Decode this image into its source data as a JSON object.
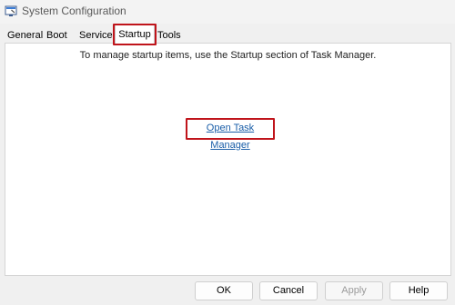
{
  "window": {
    "title": "System Configuration",
    "icon": "system-configuration-icon"
  },
  "tabs": [
    {
      "label": "General"
    },
    {
      "label": "Boot"
    },
    {
      "label": "Services"
    },
    {
      "label": "Startup",
      "selected": true
    },
    {
      "label": "Tools"
    }
  ],
  "startup_panel": {
    "message": "To manage startup items, use the Startup section of Task Manager.",
    "link_label": "Open Task Manager"
  },
  "buttons": {
    "ok": "OK",
    "cancel": "Cancel",
    "apply": "Apply",
    "help": "Help"
  },
  "colors": {
    "highlight": "#c0141b",
    "link": "#1a5ea8"
  }
}
